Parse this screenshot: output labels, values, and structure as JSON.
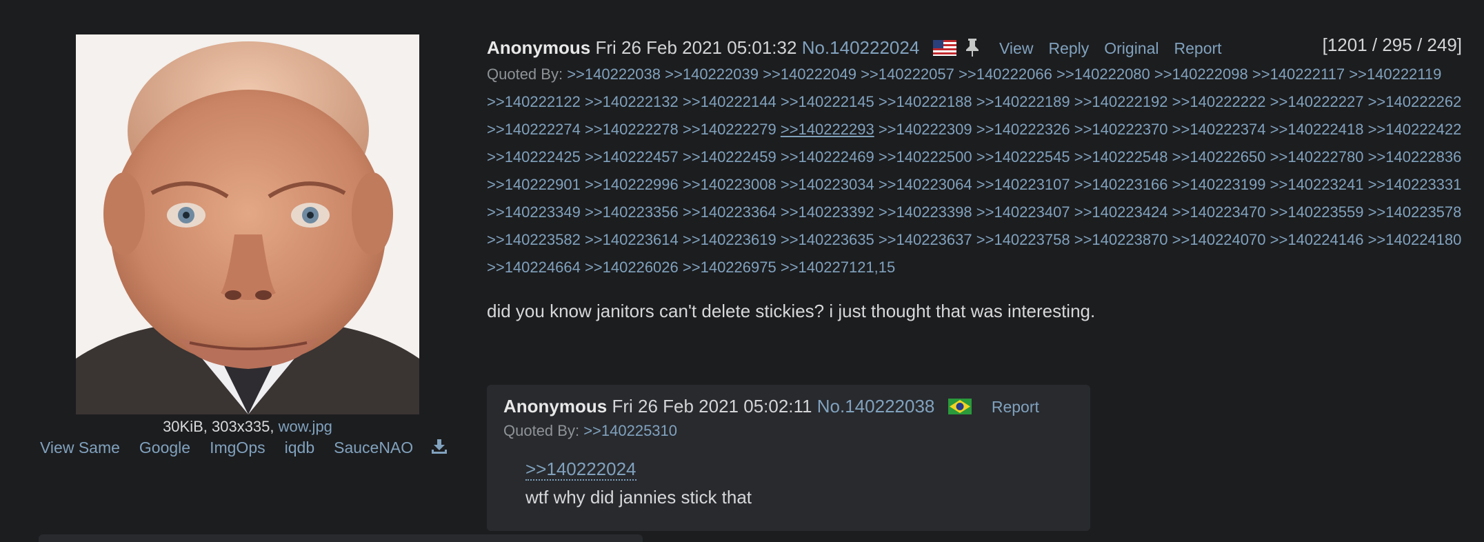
{
  "file": {
    "size_dims": "30KiB, 303x335, ",
    "filename": "wow.jpg",
    "links": [
      "View Same",
      "Google",
      "ImgOps",
      "iqdb",
      "SauceNAO"
    ],
    "download_icon": "download-icon"
  },
  "op": {
    "name": "Anonymous",
    "date": "Fri 26 Feb 2021 05:01:32",
    "post_no": "No.140222024",
    "flag": "us-flag-icon",
    "pin": "pin-icon",
    "controls": {
      "view": "View",
      "reply": "Reply",
      "original": "Original",
      "report": "Report"
    },
    "stats": "[1201 / 295 / 249]",
    "quoted_by_label": "Quoted By:",
    "quoted_by": [
      ">>140222038",
      ">>140222039",
      ">>140222049",
      ">>140222057",
      ">>140222066",
      ">>140222080",
      ">>140222098",
      ">>140222117",
      ">>140222119",
      ">>140222122",
      ">>140222132",
      ">>140222144",
      ">>140222145",
      ">>140222188",
      ">>140222189",
      ">>140222192",
      ">>140222222",
      ">>140222227",
      ">>140222262",
      ">>140222274",
      ">>140222278",
      ">>140222279",
      ">>140222293",
      ">>140222309",
      ">>140222326",
      ">>140222370",
      ">>140222374",
      ">>140222418",
      ">>140222422",
      ">>140222425",
      ">>140222457",
      ">>140222459",
      ">>140222469",
      ">>140222500",
      ">>140222545",
      ">>140222548",
      ">>140222650",
      ">>140222780",
      ">>140222836",
      ">>140222901",
      ">>140222996",
      ">>140223008",
      ">>140223034",
      ">>140223064",
      ">>140223107",
      ">>140223166",
      ">>140223199",
      ">>140223241",
      ">>140223331",
      ">>140223349",
      ">>140223356",
      ">>140223364",
      ">>140223392",
      ">>140223398",
      ">>140223407",
      ">>140223424",
      ">>140223470",
      ">>140223559",
      ">>140223578",
      ">>140223582",
      ">>140223614",
      ">>140223619",
      ">>140223635",
      ">>140223637",
      ">>140223758",
      ">>140223870",
      ">>140224070",
      ">>140224146",
      ">>140224180",
      ">>140224664",
      ">>140226026",
      ">>140226975",
      ">>140227121,15"
    ],
    "hovered_quote": ">>140222293",
    "text": "did you know janitors can't delete stickies? i just thought that was interesting."
  },
  "reply": {
    "name": "Anonymous",
    "date": "Fri 26 Feb 2021 05:02:11",
    "post_no": "No.140222038",
    "flag": "brazil-flag-icon",
    "report": "Report",
    "quoted_by_label": "Quoted By:",
    "quoted_by": ">>140225310",
    "quote_link": ">>140222024",
    "text": "wtf why did jannies stick that"
  },
  "colors": {
    "background": "#1c1d1f",
    "post_bg": "#282a2e",
    "link": "#81a2be",
    "text": "#c5c8c6"
  }
}
